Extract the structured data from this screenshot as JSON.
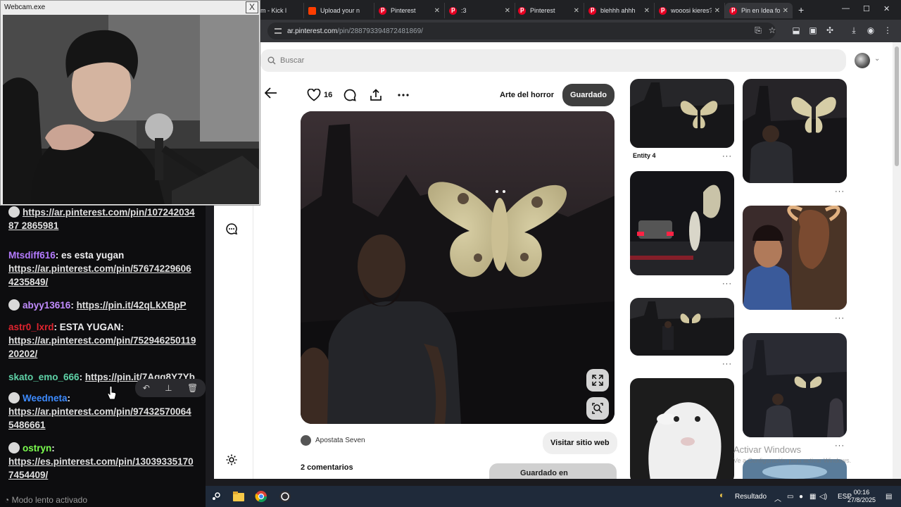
{
  "webcam": {
    "title": "Webcam.exe",
    "close": "X"
  },
  "browser": {
    "tabs": [
      {
        "label": "m - Kick l",
        "active": false
      },
      {
        "label": "Upload your n",
        "active": false
      },
      {
        "label": "Pinterest",
        "active": false
      },
      {
        "label": ":3",
        "active": false
      },
      {
        "label": "Pinterest",
        "active": false
      },
      {
        "label": "blehhh ahhh",
        "active": false
      },
      {
        "label": "wooosi kieres?",
        "active": false
      },
      {
        "label": "Pin en Idea for",
        "active": true
      }
    ],
    "new_tab": "+",
    "url_domain": "ar.pinterest.com",
    "url_path": "/pin/288793394872481869/"
  },
  "pinterest": {
    "search_placeholder": "Buscar",
    "likes": "16",
    "board": "Arte del horror",
    "saved_label": "Guardado",
    "creator": "Apostata Seven",
    "visit_label": "Visitar sitio web",
    "comments_label": "2 comentarios",
    "saved_in_label": "Guardado en",
    "thumb_titles": [
      "Entity 4"
    ],
    "more": "···"
  },
  "watermark": {
    "title": "Activar Windows",
    "subtitle": "Ve a Configuración para activar Windows."
  },
  "chat": {
    "messages": [
      {
        "user": "",
        "color": "#ffffff",
        "badge": true,
        "text": "",
        "link": "https://ar.pinterest.com/pin/10724203487 2865981"
      },
      {
        "user": "Mtsdiff616",
        "color": "#b57bff",
        "badge": false,
        "text": ": es esta yugan",
        "link": "https://ar.pinterest.com/pin/57674229606 4235849/"
      },
      {
        "user": "abyy13616",
        "color": "#c18cff",
        "badge": true,
        "text": ": ",
        "link": "https://pin.it/42qLkXBpP"
      },
      {
        "user": "astr0_lxrd",
        "color": "#e0242f",
        "badge": false,
        "text": ": ESTA YUGAN:",
        "link": "https://ar.pinterest.com/pin/752946250119 20202/"
      },
      {
        "user": "skato_emo_666",
        "color": "#5fd3a8",
        "badge": false,
        "text": ": ",
        "link": "https://pin.it/7Aqg8Y7Yb"
      },
      {
        "user": "Weedneta",
        "color": "#3d8bff",
        "badge": true,
        "text": ":",
        "link": "https://ar.pinterest.com/pin/97432570064 5486661"
      },
      {
        "user": "ostryn",
        "color": "#7cff4f",
        "badge": true,
        "text": ":",
        "link": "https://es.pinterest.com/pin/13039335170 7454409/"
      }
    ],
    "slow_mode": "Modo lento activado"
  },
  "taskbar": {
    "result_label": "Resultado",
    "lang": "ESP",
    "time": "00:16",
    "date": "27/8/2025"
  }
}
